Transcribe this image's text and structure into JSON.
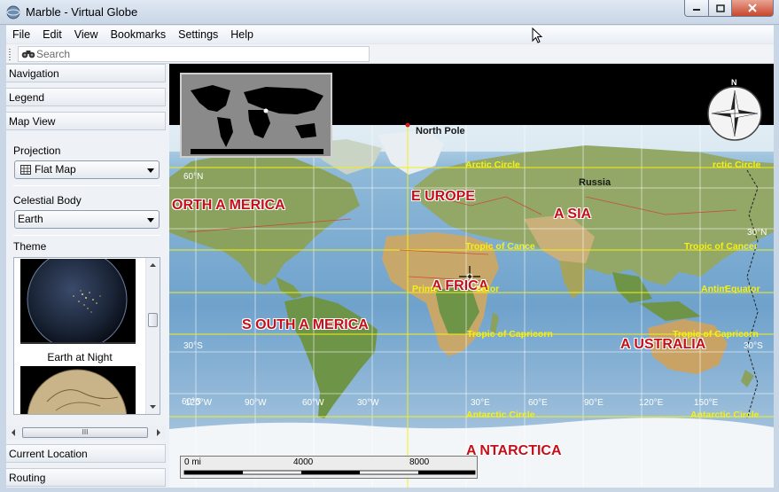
{
  "window": {
    "title": "Marble - Virtual Globe"
  },
  "menu": [
    "File",
    "Edit",
    "View",
    "Bookmarks",
    "Settings",
    "Help"
  ],
  "search": {
    "placeholder": "Search"
  },
  "sidebar": {
    "sections": {
      "navigation": "Navigation",
      "legend": "Legend",
      "map_view": "Map View",
      "current_location": "Current Location",
      "routing": "Routing"
    },
    "projection": {
      "label": "Projection",
      "value": "Flat Map"
    },
    "celestial_body": {
      "label": "Celestial Body",
      "value": "Earth"
    },
    "theme": {
      "label": "Theme",
      "items": [
        "Earth at Night"
      ]
    },
    "scroll_grip": "III"
  },
  "map": {
    "continents": [
      "ORTH A MERICA",
      "E UROPE",
      "A SIA",
      "A FRICA",
      "S OUTH A MERICA",
      "A USTRALIA",
      "A NTARCTICA"
    ],
    "places": {
      "north_pole": "North Pole",
      "russia": "Russia"
    },
    "circles": {
      "arctic": "Arctic Circle",
      "arctic_right": "rctic Circle",
      "tropic_cancer": "Tropic of Cancer",
      "tropic_cancer_mid": "Tropic of Cance",
      "tropic_capricorn": "Tropic of Capricorn",
      "tropic_capricorn_right": "Tropic of Capricorn",
      "equator_mid": "Prime",
      "equator_mid2": "uator",
      "equator_right": "Antim",
      "equator_right2": "Equator",
      "antarctic": "Antarctic Circle",
      "antarctic_right": "Antarctic Circle"
    },
    "lat_labels": [
      "60°N",
      "30°N",
      "30°S",
      "30°S",
      "60°S"
    ],
    "lon_labels": [
      "120°W",
      "90°W",
      "60°W",
      "30°W",
      "30°E",
      "60°E",
      "90°E",
      "120°E",
      "150°E"
    ],
    "scale": {
      "labels": [
        "0 mi",
        "4000",
        "8000"
      ]
    },
    "compass": {
      "label": "N"
    }
  },
  "colors": {
    "accent": "#3a6ea5",
    "continent": "#c3101a",
    "circle_lines": "#f4f016"
  }
}
